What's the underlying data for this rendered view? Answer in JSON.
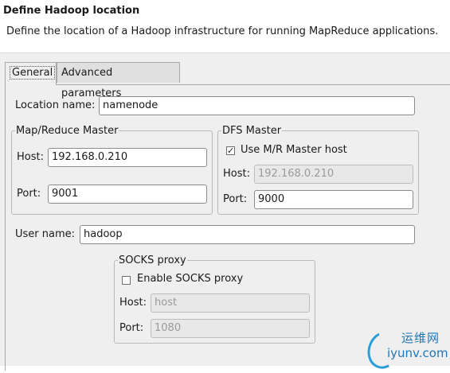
{
  "header": {
    "title": "Define Hadoop location",
    "description": "Define the location of a Hadoop infrastructure for running MapReduce applications."
  },
  "tabs": [
    {
      "label": "General",
      "active": true
    },
    {
      "label": "Advanced parameters",
      "active": false
    }
  ],
  "general": {
    "location_name": {
      "label": "Location name:",
      "value": "namenode"
    },
    "mapreduce_master": {
      "title": "Map/Reduce Master",
      "host_label": "Host:",
      "host_value": "192.168.0.210",
      "port_label": "Port:",
      "port_value": "9001"
    },
    "dfs_master": {
      "title": "DFS Master",
      "use_mr_label": "Use M/R Master host",
      "use_mr_checked": true,
      "host_label": "Host:",
      "host_value": "192.168.0.210",
      "port_label": "Port:",
      "port_value": "9000"
    },
    "user_name": {
      "label": "User name:",
      "value": "hadoop"
    },
    "socks_proxy": {
      "title": "SOCKS proxy",
      "enable_label": "Enable SOCKS proxy",
      "enable_checked": false,
      "host_label": "Host:",
      "host_value": "host",
      "port_label": "Port:",
      "port_value": "1080"
    }
  },
  "watermark": {
    "line1": "运维网",
    "line2": "iyunv.com"
  }
}
